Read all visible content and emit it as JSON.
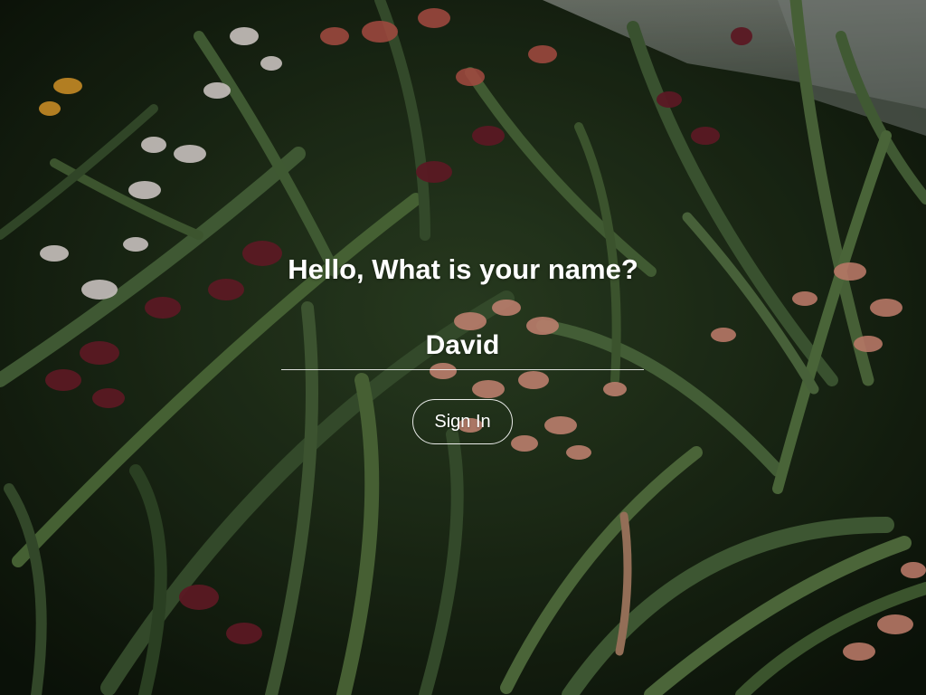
{
  "greeting": {
    "heading": "Hello, What is your name?"
  },
  "name_input": {
    "value": "David",
    "placeholder": ""
  },
  "sign_in": {
    "label": "Sign In"
  },
  "background": {
    "description": "dark green foliage with pink and white orchids"
  },
  "colors": {
    "text": "#ffffff",
    "foliage_dark": "#13200f",
    "foliage": "#3f5a34",
    "orchid_pink": "#e49a85",
    "orchid_maroon": "#6f1f2b",
    "orchid_white": "#eee6e2"
  }
}
